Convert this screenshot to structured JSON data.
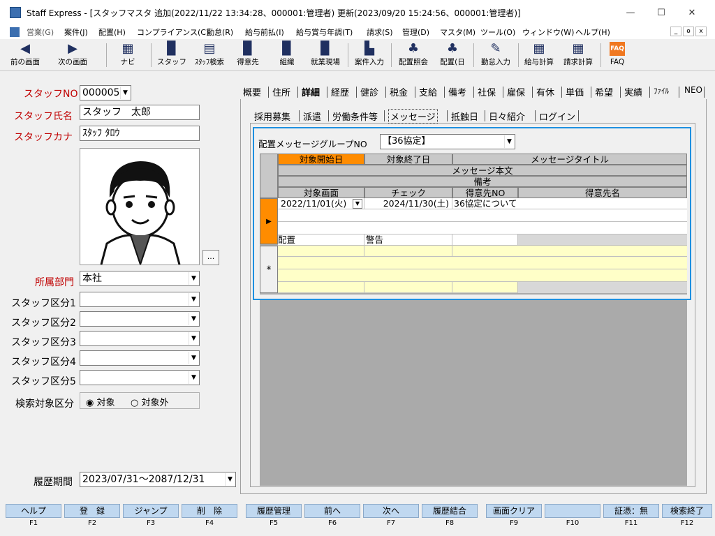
{
  "window": {
    "title": "Staff Express - [スタッフマスタ 追加(2022/11/22 13:34:28、000001:管理者) 更新(2023/09/20 15:24:56、000001:管理者)]",
    "minimize": "—",
    "maximize": "☐",
    "close": "✕"
  },
  "menu": [
    "営業(G)",
    "案件(J)",
    "配置(H)",
    "コンプライアンス(C)",
    "勤怠(R)",
    "給与前払(I)",
    "給与賞与年調(T)",
    "請求(S)",
    "管理(D)",
    "マスタ(M)",
    "ツール(O)",
    "ウィンドウ(W)",
    "ヘルプ(H)"
  ],
  "mdi": [
    "_",
    "ɵ",
    "x"
  ],
  "toolbar": [
    {
      "icon": "arrow-left-icon",
      "glyph": "◀",
      "label": "前の画面"
    },
    {
      "icon": "arrow-right-icon",
      "glyph": "▶",
      "label": "次の画面"
    },
    {
      "icon": "keyboard-icon",
      "glyph": "▦",
      "label": "ナビ"
    },
    {
      "icon": "staff-icon",
      "glyph": "▉",
      "label": "スタッフ"
    },
    {
      "icon": "staff-search-icon",
      "glyph": "▤",
      "label": "ｽﾀｯﾌ検索"
    },
    {
      "icon": "client-icon",
      "glyph": "▉",
      "label": "得意先"
    },
    {
      "icon": "organization-icon",
      "glyph": "▉",
      "label": "組織"
    },
    {
      "icon": "worksite-icon",
      "glyph": "▉",
      "label": "就業現場"
    },
    {
      "icon": "case-input-icon",
      "glyph": "▙",
      "label": "案件入力"
    },
    {
      "icon": "placement-inquiry-icon",
      "glyph": "♣",
      "label": "配置照会"
    },
    {
      "icon": "placement-day-icon",
      "glyph": "♣",
      "label": "配置(日"
    },
    {
      "icon": "attendance-input-icon",
      "glyph": "✎",
      "label": "勤怠入力"
    },
    {
      "icon": "payroll-calc-icon",
      "glyph": "▦",
      "label": "給与計算"
    },
    {
      "icon": "billing-calc-icon",
      "glyph": "▦",
      "label": "請求計算"
    },
    {
      "icon": "faq-icon",
      "glyph": "FAQ",
      "label": "FAQ"
    }
  ],
  "left": {
    "staff_no_label": "スタッフNO",
    "staff_no": "000005",
    "staff_name_label": "スタッフ氏名",
    "staff_name": "スタッフ　太郎",
    "staff_kana_label": "スタッフカナ",
    "staff_kana": "ｽﾀｯﾌ ﾀﾛｳ",
    "photo_button": "...",
    "dept_label": "所属部門",
    "dept": "本社",
    "categories": [
      "スタッフ区分1",
      "スタッフ区分2",
      "スタッフ区分3",
      "スタッフ区分4",
      "スタッフ区分5"
    ],
    "search_label": "検索対象区分",
    "radio_on": "対象",
    "radio_off": "対象外",
    "history_label": "履歴期間",
    "history": "2023/07/31～2087/12/31"
  },
  "tabs_top": [
    "概要",
    "住所",
    "詳細",
    "経歴",
    "健診",
    "税金",
    "支給",
    "備考",
    "社保",
    "雇保",
    "有休",
    "単価",
    "希望",
    "実績",
    "ﾌｧｲﾙ",
    "NEO"
  ],
  "tabs_sub": [
    "採用募集",
    "派遣",
    "労働条件等",
    "メッセージ",
    "抵触日",
    "日々紹介",
    "ログイン"
  ],
  "message": {
    "group_label": "配置メッセージグループNO",
    "group_value": "【36協定】",
    "headers": {
      "start": "対象開始日",
      "end": "対象終了日",
      "title": "メッセージタイトル",
      "body": "メッセージ本文",
      "note": "備考",
      "screen": "対象画面",
      "check": "チェック",
      "client_no": "得意先NO",
      "client_name": "得意先名"
    },
    "row1": {
      "start": "2022/11/01(火)",
      "end": "2024/11/30(土)",
      "title": "36協定について",
      "screen": "配置",
      "check": "警告"
    },
    "new_marker": "*",
    "current_marker": "▶"
  },
  "fkeys": [
    {
      "label": "ヘルプ",
      "key": "F1"
    },
    {
      "label": "登　録",
      "key": "F2"
    },
    {
      "label": "ジャンプ",
      "key": "F3"
    },
    {
      "label": "削　除",
      "key": "F4"
    },
    {
      "label": "履歴管理",
      "key": "F5"
    },
    {
      "label": "前へ",
      "key": "F6"
    },
    {
      "label": "次へ",
      "key": "F7"
    },
    {
      "label": "履歴結合",
      "key": "F8"
    },
    {
      "label": "画面クリア",
      "key": "F9"
    },
    {
      "label": "",
      "key": "F10"
    },
    {
      "label": "証憑：無",
      "key": "F11"
    },
    {
      "label": "検索終了",
      "key": "F12"
    }
  ]
}
